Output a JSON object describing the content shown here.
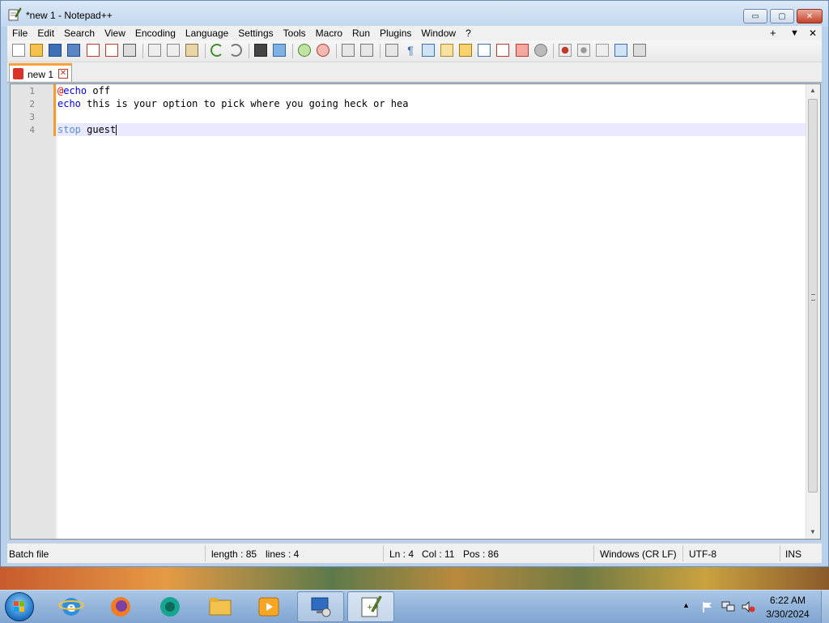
{
  "window": {
    "title": "*new 1 - Notepad++",
    "minimize_glyph": "▭",
    "maximize_glyph": "▢",
    "close_glyph": "✕"
  },
  "menu": {
    "items": [
      "File",
      "Edit",
      "Search",
      "View",
      "Encoding",
      "Language",
      "Settings",
      "Tools",
      "Macro",
      "Run",
      "Plugins",
      "Window",
      "?"
    ],
    "right_plus": "+",
    "right_dropdown": "▼",
    "right_close": "✕"
  },
  "tab": {
    "label": "new 1",
    "close_glyph": "✕"
  },
  "editor": {
    "line_numbers": [
      "1",
      "2",
      "3",
      "4"
    ],
    "lines": {
      "l1_at": "@",
      "l1_kw": "echo",
      "l1_rest": " off",
      "l2_kw": "echo",
      "l2_rest": " this is your option to pick where you going heck or hea",
      "l3": "",
      "l4_kw": "stop",
      "l4_rest": " guest"
    }
  },
  "statusbar": {
    "language": "Batch file",
    "length": "length : 85",
    "lines": "lines : 4",
    "ln": "Ln : 4",
    "col": "Col : 11",
    "pos": "Pos : 86",
    "eol": "Windows (CR LF)",
    "encoding": "UTF-8",
    "mode": "INS"
  },
  "taskbar": {
    "time": "6:22 AM",
    "date": "3/30/2024",
    "tray_arrow": "▲"
  },
  "colors": {
    "accent_orange": "#f39c2e",
    "keyword_blue": "#0000ff",
    "at_red": "#ff0000"
  }
}
